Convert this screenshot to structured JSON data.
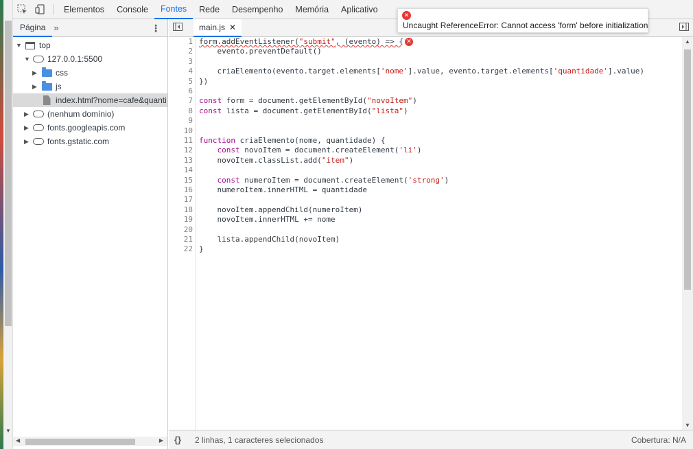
{
  "toolbar": {
    "tabs": [
      "Elementos",
      "Console",
      "Fontes",
      "Rede",
      "Desempenho",
      "Memória",
      "Aplicativo"
    ],
    "active_tab": "Fontes",
    "icons": [
      "inspect-element-icon",
      "device-toolbar-icon"
    ]
  },
  "navigator": {
    "tab_label": "Página",
    "tree": [
      {
        "label": "top",
        "icon": "frame-icon",
        "expanded": true
      },
      {
        "label": "127.0.0.1:5500",
        "icon": "cloud-icon",
        "expanded": true
      },
      {
        "label": "css",
        "icon": "folder-icon",
        "expanded": false
      },
      {
        "label": "js",
        "icon": "folder-icon",
        "expanded": false
      },
      {
        "label": "index.html?nome=cafe&quanti",
        "icon": "file-icon",
        "selected": true
      },
      {
        "label": "(nenhum domínio)",
        "icon": "cloud-icon",
        "expanded": false
      },
      {
        "label": "fonts.googleapis.com",
        "icon": "cloud-icon",
        "expanded": false
      },
      {
        "label": "fonts.gstatic.com",
        "icon": "cloud-icon",
        "expanded": false
      }
    ]
  },
  "editor": {
    "file_tab": "main.js",
    "line_numbers": [
      "1",
      "2",
      "3",
      "4",
      "5",
      "6",
      "7",
      "8",
      "9",
      "10",
      "11",
      "12",
      "13",
      "14",
      "15",
      "16",
      "17",
      "18",
      "19",
      "20",
      "21",
      "22"
    ]
  },
  "error_tooltip": {
    "message": "Uncaught ReferenceError: Cannot access 'form' before initialization"
  },
  "status_bar": {
    "selection": "2 linhas, 1 caracteres selecionados",
    "coverage": "Cobertura: N/A"
  },
  "colors": {
    "accent": "#1a73e8",
    "error": "#e53935",
    "keyword": "#aa0d91",
    "string": "#c41a16"
  }
}
